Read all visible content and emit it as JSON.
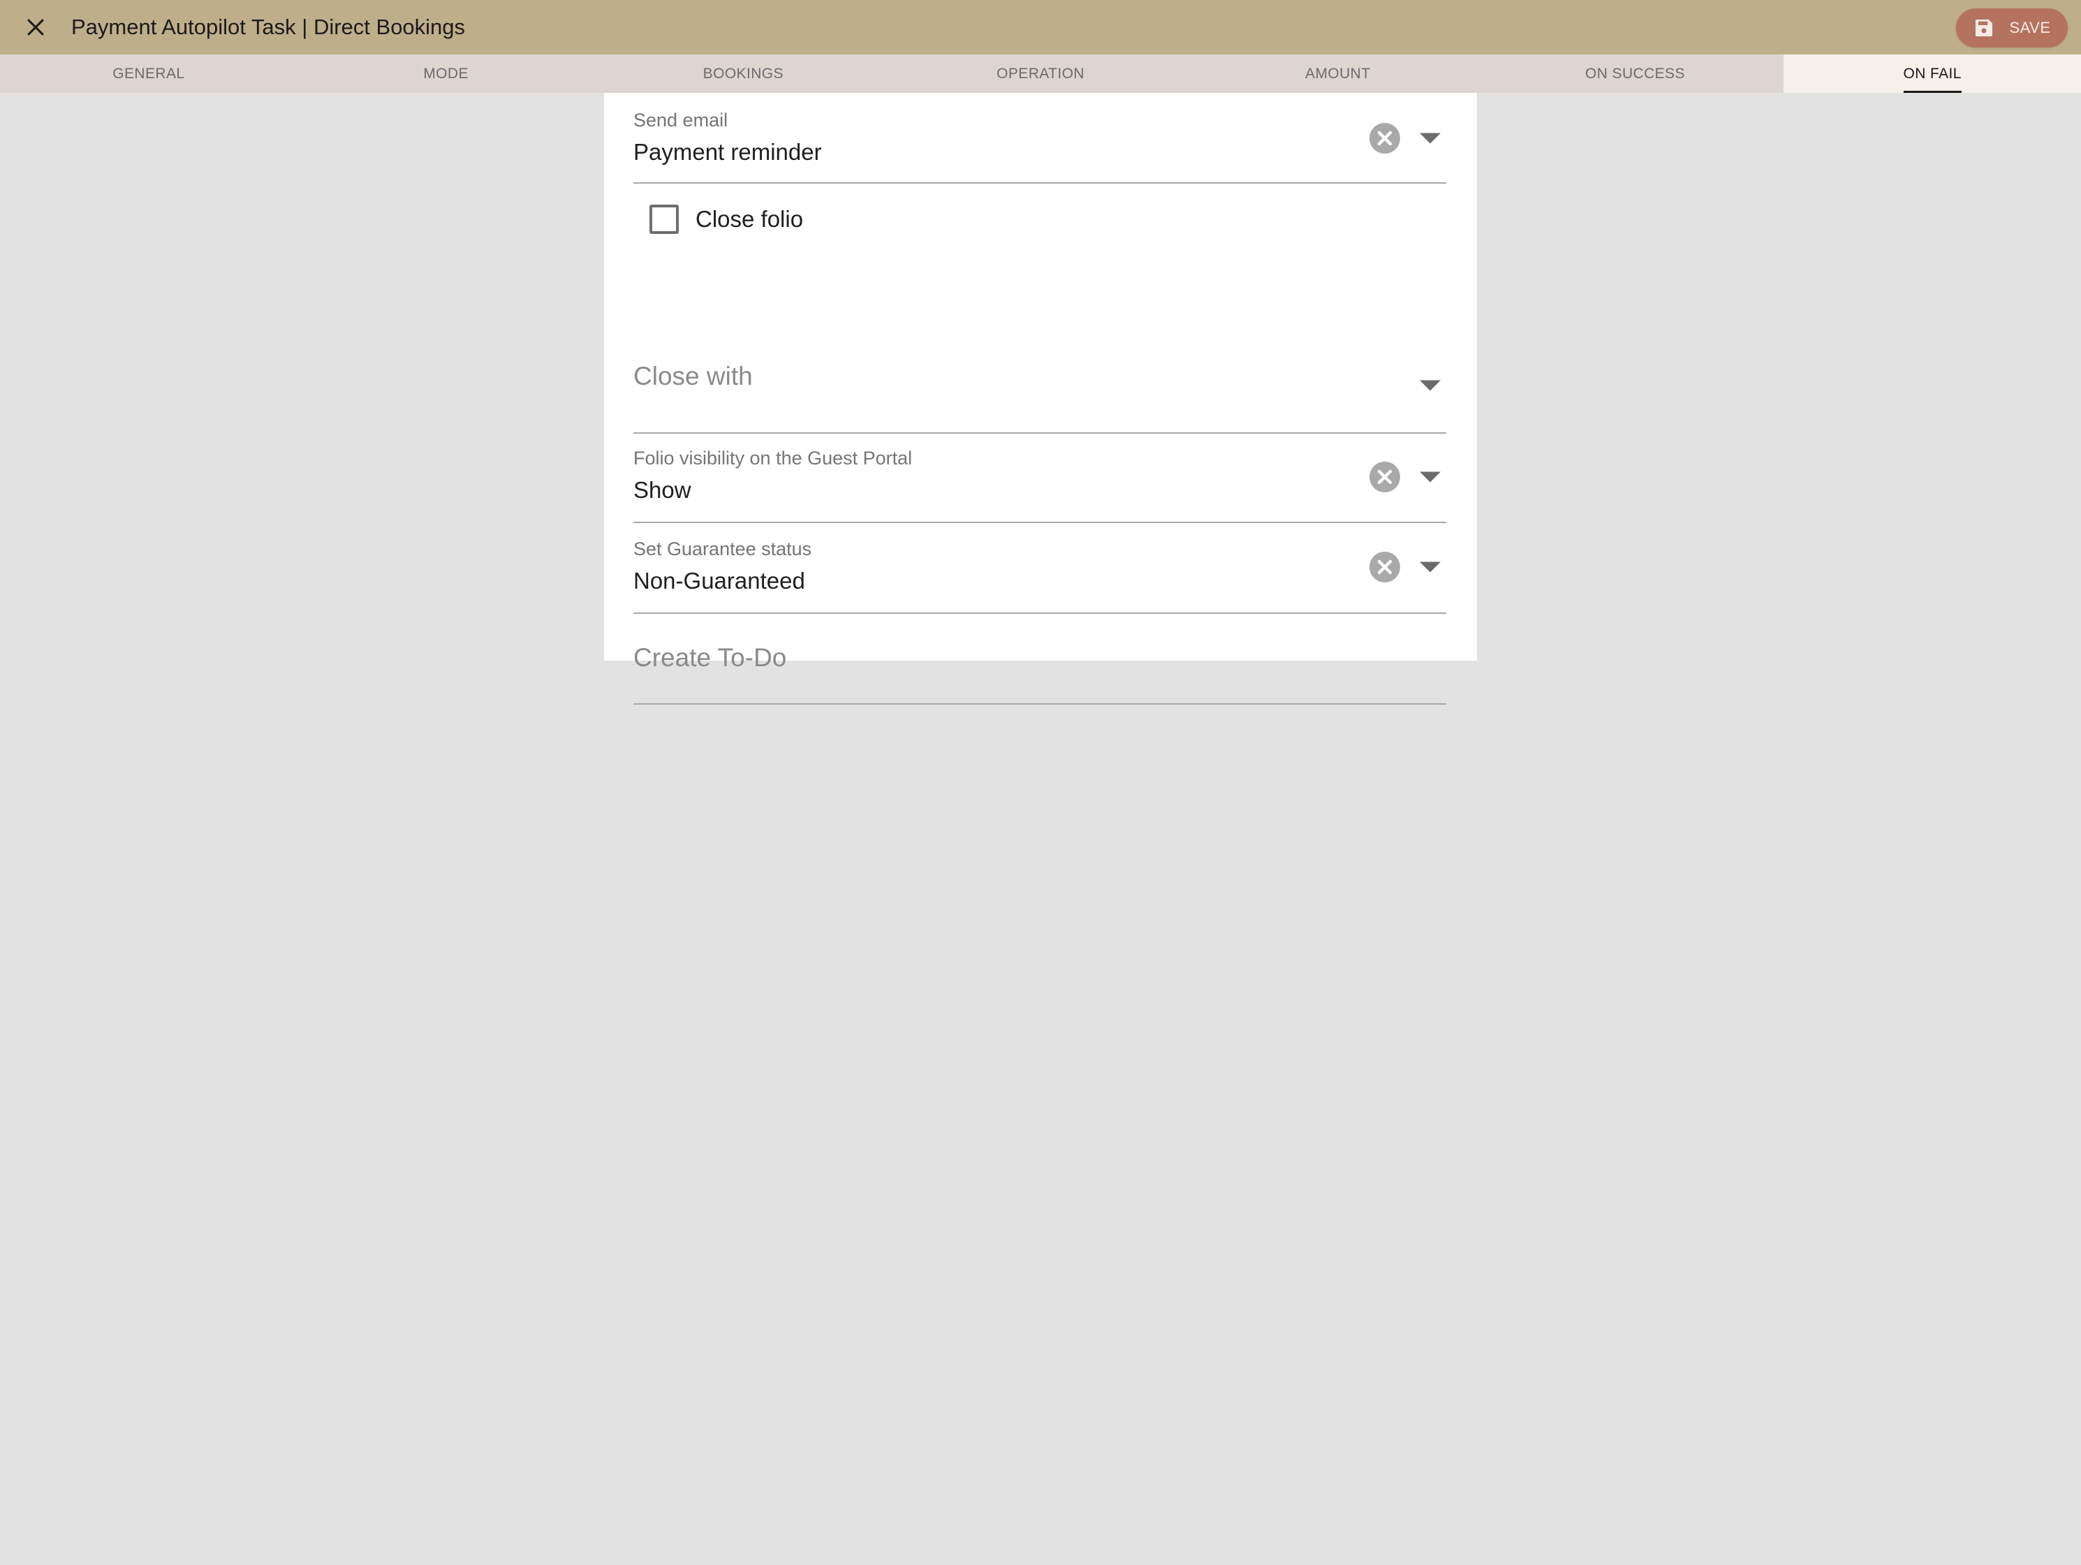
{
  "app": {
    "title": "Payment Autopilot Task | Direct Bookings",
    "save_label": "SAVE",
    "accent": "#bfae8a",
    "save_color": "#b5735f"
  },
  "tabs": [
    {
      "label": "GENERAL",
      "active": false
    },
    {
      "label": "MODE",
      "active": false
    },
    {
      "label": "BOOKINGS",
      "active": false
    },
    {
      "label": "OPERATION",
      "active": false
    },
    {
      "label": "AMOUNT",
      "active": false
    },
    {
      "label": "ON SUCCESS",
      "active": false
    },
    {
      "label": "ON FAIL",
      "active": true
    }
  ],
  "form": {
    "send_email": {
      "label": "Send email",
      "value": "Payment reminder"
    },
    "close_folio": {
      "label": "Close folio",
      "checked": false
    },
    "close_with": {
      "placeholder": "Close with"
    },
    "folio_visibility": {
      "label": "Folio visibility on the Guest Portal",
      "value": "Show"
    },
    "guarantee_status": {
      "label": "Set Guarantee status",
      "value": "Non-Guaranteed"
    },
    "create_todo": {
      "placeholder": "Create To-Do"
    }
  },
  "icons": {
    "close": "close-icon",
    "save": "floppy-disk-icon",
    "clear": "clear-circle-icon",
    "dropdown": "caret-down-icon"
  }
}
